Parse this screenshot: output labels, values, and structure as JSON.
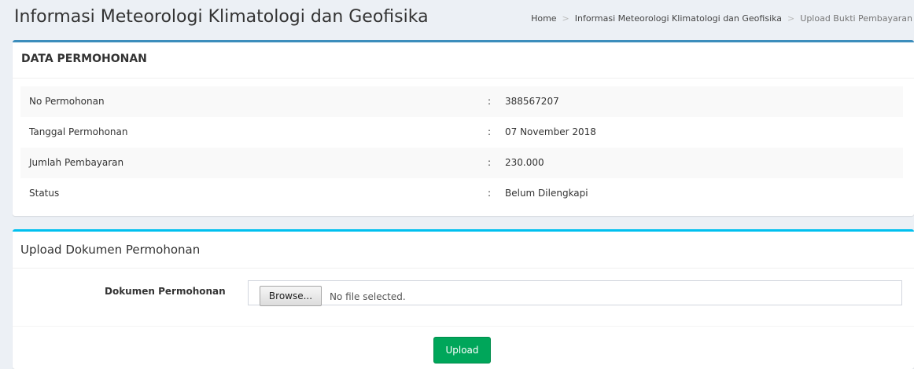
{
  "header": {
    "title": "Informasi Meteorologi Klimatologi dan Geofisika",
    "breadcrumb": [
      "Home",
      "Informasi Meteorologi Klimatologi dan Geofisika",
      "Upload Bukti Pembayaran"
    ],
    "breadcrumb_separator": ">"
  },
  "data_permohonan": {
    "title": "DATA PERMOHONAN",
    "colon": ":",
    "rows": [
      {
        "label": "No Permohonan",
        "value": "388567207"
      },
      {
        "label": "Tanggal Permohonan",
        "value": "07 November 2018"
      },
      {
        "label": "Jumlah Pembayaran",
        "value": "230.000"
      },
      {
        "label": "Status",
        "value": "Belum Dilengkapi"
      }
    ]
  },
  "upload": {
    "title": "Upload Dokumen Permohonan",
    "field_label": "Dokumen Permohonan",
    "browse_label": "Browse...",
    "file_status": "No file selected.",
    "submit_label": "Upload"
  },
  "colors": {
    "background": "#ecf0f5",
    "box_border_primary": "#3c8dbc",
    "box_border_info": "#00c0ef",
    "upload_button": "#00a65a"
  }
}
